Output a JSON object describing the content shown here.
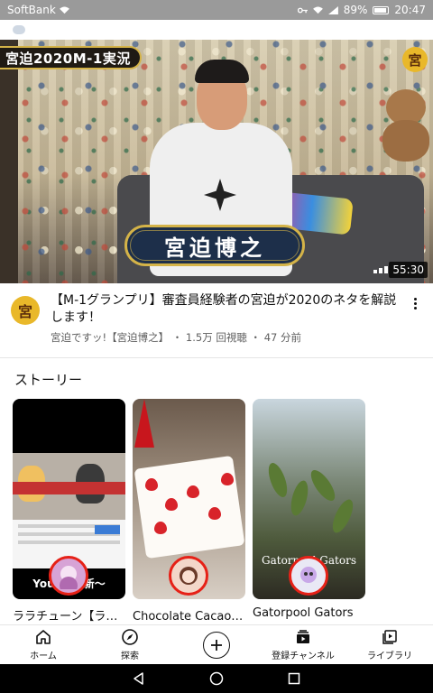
{
  "status_bar": {
    "carrier": "SoftBank",
    "battery": "89%",
    "time": "20:47"
  },
  "video": {
    "thumbnail": {
      "badge_text": "宮迫2020M-1実況",
      "corner_logo": "宮",
      "name_plate": "宮迫博之",
      "duration": "55:30"
    },
    "channel_avatar_text": "宮",
    "title": "【M-1グランプリ】審査員経験者の宮迫が2020のネタを解説します！",
    "channel": "宮迫ですッ!【宮迫博之】",
    "views": "1.5万 回視聴",
    "age": "47 分前",
    "meta_separator": "・"
  },
  "stories": {
    "heading": "ストーリー",
    "items": [
      {
        "title": "ララチューン【ララ…",
        "overlay_caption": "YouTube新〜"
      },
      {
        "title": "Chocolate Cacao チ…"
      },
      {
        "title": "Gatorpool Gators",
        "overlay_label": "Gatorpool Gators"
      }
    ]
  },
  "bottom_nav": {
    "home": "ホーム",
    "explore": "探索",
    "subscriptions": "登録チャンネル",
    "library": "ライブラリ"
  },
  "colors": {
    "accent_red": "#e62117",
    "badge_gold": "#d4b348"
  }
}
